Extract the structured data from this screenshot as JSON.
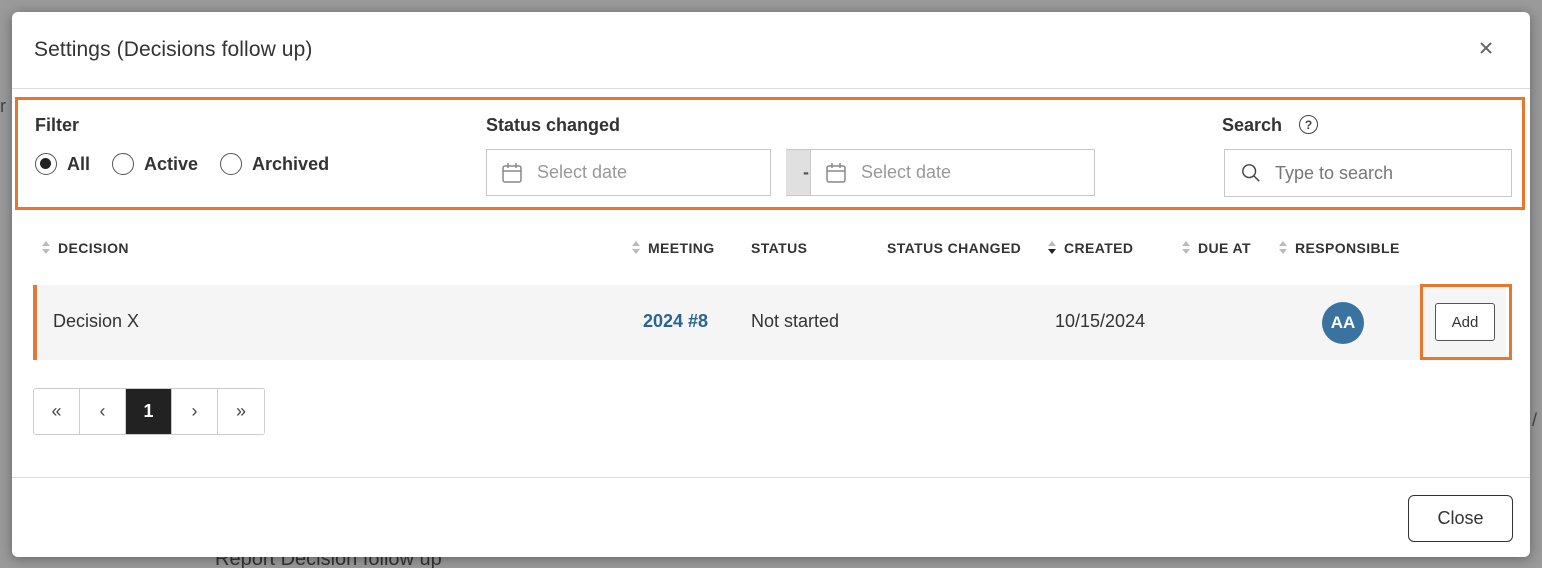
{
  "background": {
    "edge_text_left": "r",
    "edge_text_right": "/",
    "bottom_text": "Report Decision follow up"
  },
  "modal": {
    "title": "Settings (Decisions follow up)",
    "close_icon": "close-icon"
  },
  "filter": {
    "label": "Filter",
    "options": [
      {
        "label": "All",
        "checked": true
      },
      {
        "label": "Active",
        "checked": false
      },
      {
        "label": "Archived",
        "checked": false
      }
    ]
  },
  "status_changed": {
    "label": "Status changed",
    "from_placeholder": "Select date",
    "separator": "-",
    "to_placeholder": "Select date"
  },
  "search": {
    "label": "Search",
    "help_glyph": "?",
    "placeholder": "Type to search"
  },
  "table": {
    "columns": [
      {
        "label": "DECISION",
        "sortable": true
      },
      {
        "label": "MEETING",
        "sortable": true
      },
      {
        "label": "STATUS",
        "sortable": false
      },
      {
        "label": "STATUS CHANGED",
        "sortable": false
      },
      {
        "label": "CREATED",
        "sortable": true,
        "sort_dir": "desc"
      },
      {
        "label": "DUE AT",
        "sortable": true
      },
      {
        "label": "RESPONSIBLE",
        "sortable": true
      }
    ],
    "rows": [
      {
        "decision": "Decision X",
        "meeting": "2024 #8",
        "status": "Not started",
        "status_changed": "",
        "created": "10/15/2024",
        "due_at": "",
        "responsible_initials": "AA",
        "action_label": "Add"
      }
    ]
  },
  "pagination": {
    "first": "«",
    "prev": "‹",
    "current": "1",
    "next": "›",
    "last": "»"
  },
  "footer": {
    "close_label": "Close"
  },
  "colors": {
    "highlight": "#e8772e",
    "link": "#2a6496",
    "avatar": "#3a72a0",
    "row_accent": "#e07a3a"
  }
}
